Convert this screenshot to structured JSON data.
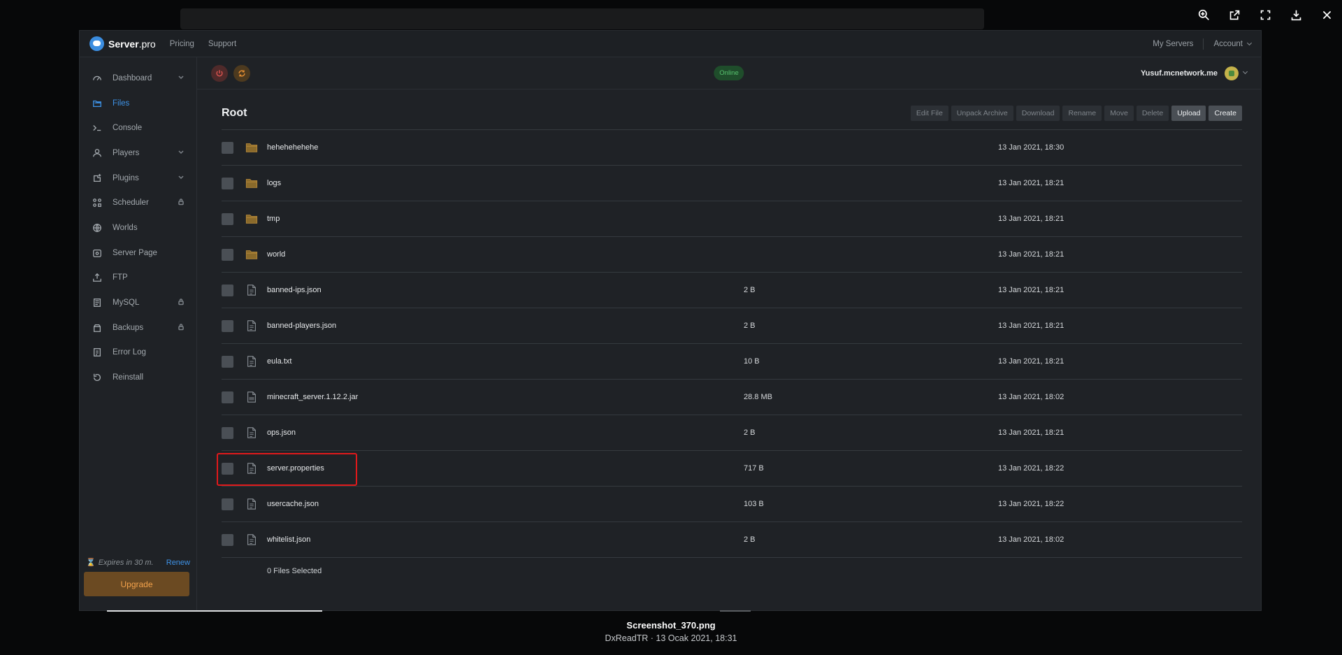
{
  "viewer": {
    "icons": [
      "zoom-in-icon",
      "open-external-icon",
      "fullscreen-icon",
      "download-icon",
      "close-icon"
    ],
    "caption_title": "Screenshot_370.png",
    "caption_sub": "DxReadTR · 13 Ocak 2021, 18:31"
  },
  "topnav": {
    "brand_bold": "Server",
    "brand_rest": ".pro",
    "links": [
      "Pricing",
      "Support"
    ],
    "my_servers": "My Servers",
    "account": "Account"
  },
  "sidebar": {
    "items": [
      {
        "label": "Dashboard",
        "icon": "dashboard-icon",
        "trail": "chevron"
      },
      {
        "label": "Files",
        "icon": "files-icon",
        "trail": "",
        "active": true
      },
      {
        "label": "Console",
        "icon": "console-icon",
        "trail": ""
      },
      {
        "label": "Players",
        "icon": "players-icon",
        "trail": "chevron"
      },
      {
        "label": "Plugins",
        "icon": "plugins-icon",
        "trail": "chevron"
      },
      {
        "label": "Scheduler",
        "icon": "scheduler-icon",
        "trail": "lock"
      },
      {
        "label": "Worlds",
        "icon": "worlds-icon",
        "trail": ""
      },
      {
        "label": "Server Page",
        "icon": "server-page-icon",
        "trail": ""
      },
      {
        "label": "FTP",
        "icon": "ftp-icon",
        "trail": ""
      },
      {
        "label": "MySQL",
        "icon": "mysql-icon",
        "trail": "lock"
      },
      {
        "label": "Backups",
        "icon": "backups-icon",
        "trail": "lock"
      },
      {
        "label": "Error Log",
        "icon": "error-log-icon",
        "trail": ""
      },
      {
        "label": "Reinstall",
        "icon": "reinstall-icon",
        "trail": ""
      }
    ],
    "expires": "Expires in 30 m.",
    "renew": "Renew",
    "upgrade": "Upgrade"
  },
  "control": {
    "status": "Online",
    "user": "Yusuf.mcnetwork.me"
  },
  "files": {
    "title": "Root",
    "actions": [
      "Edit File",
      "Unpack Archive",
      "Download",
      "Rename",
      "Move",
      "Delete",
      "Upload",
      "Create"
    ],
    "rows": [
      {
        "name": "hehehehehehe",
        "type": "folder",
        "size": "",
        "date": "13 Jan 2021, 18:30"
      },
      {
        "name": "logs",
        "type": "folder",
        "size": "",
        "date": "13 Jan 2021, 18:21"
      },
      {
        "name": "tmp",
        "type": "folder",
        "size": "",
        "date": "13 Jan 2021, 18:21"
      },
      {
        "name": "world",
        "type": "folder",
        "size": "",
        "date": "13 Jan 2021, 18:21"
      },
      {
        "name": "banned-ips.json",
        "type": "file",
        "size": "2 B",
        "date": "13 Jan 2021, 18:21"
      },
      {
        "name": "banned-players.json",
        "type": "file",
        "size": "2 B",
        "date": "13 Jan 2021, 18:21"
      },
      {
        "name": "eula.txt",
        "type": "file",
        "size": "10 B",
        "date": "13 Jan 2021, 18:21"
      },
      {
        "name": "minecraft_server.1.12.2.jar",
        "type": "jar",
        "size": "28.8 MB",
        "date": "13 Jan 2021, 18:02"
      },
      {
        "name": "ops.json",
        "type": "file",
        "size": "2 B",
        "date": "13 Jan 2021, 18:21"
      },
      {
        "name": "server.properties",
        "type": "file",
        "size": "717 B",
        "date": "13 Jan 2021, 18:22",
        "highlighted": true
      },
      {
        "name": "usercache.json",
        "type": "file",
        "size": "103 B",
        "date": "13 Jan 2021, 18:22"
      },
      {
        "name": "whitelist.json",
        "type": "file",
        "size": "2 B",
        "date": "13 Jan 2021, 18:02"
      }
    ],
    "selected": "0 Files Selected"
  },
  "colors": {
    "accent": "#3e92e6",
    "highlight": "#e0191b",
    "upgrade_text": "#f3a24c",
    "online": "#58c26f",
    "folder": "#b7893a"
  }
}
